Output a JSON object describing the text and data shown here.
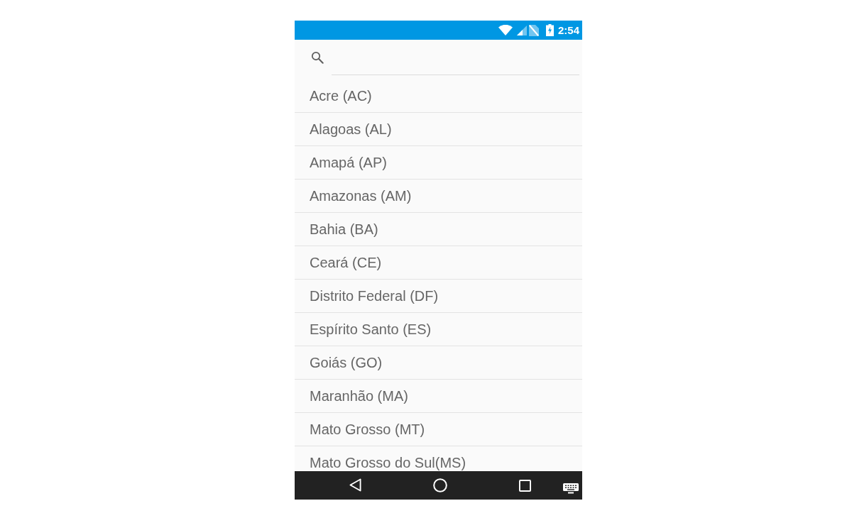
{
  "status_bar": {
    "time": "2:54"
  },
  "list": {
    "items": [
      "Acre (AC)",
      "Alagoas (AL)",
      "Amapá (AP)",
      "Amazonas (AM)",
      "Bahia (BA)",
      "Ceará (CE)",
      "Distrito Federal (DF)",
      "Espírito Santo (ES)",
      "Goiás (GO)",
      "Maranhão (MA)",
      "Mato Grosso (MT)",
      "Mato Grosso do Sul(MS)"
    ]
  }
}
